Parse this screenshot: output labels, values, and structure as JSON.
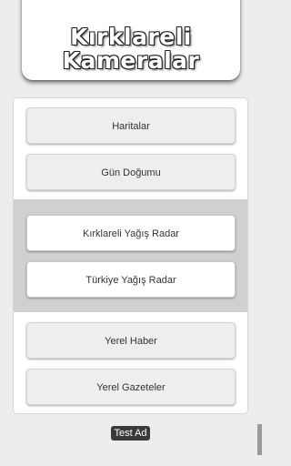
{
  "header": {
    "title_line1": "Kırklareli",
    "title_line2": "Kameralar"
  },
  "menu": {
    "maps_label": "Haritalar",
    "sunrise_label": "Gün Doğumu",
    "local_radar_label": "Kırklareli Yağış Radar",
    "turkey_radar_label": "Türkiye Yağış Radar",
    "local_news_label": "Yerel Haber",
    "local_papers_label": "Yerel Gazeteler"
  },
  "ad": {
    "label": "Test Ad"
  },
  "colors": {
    "background": "#ededed",
    "band": "#d0d0d0",
    "ad_badge": "#3a3a3a"
  }
}
